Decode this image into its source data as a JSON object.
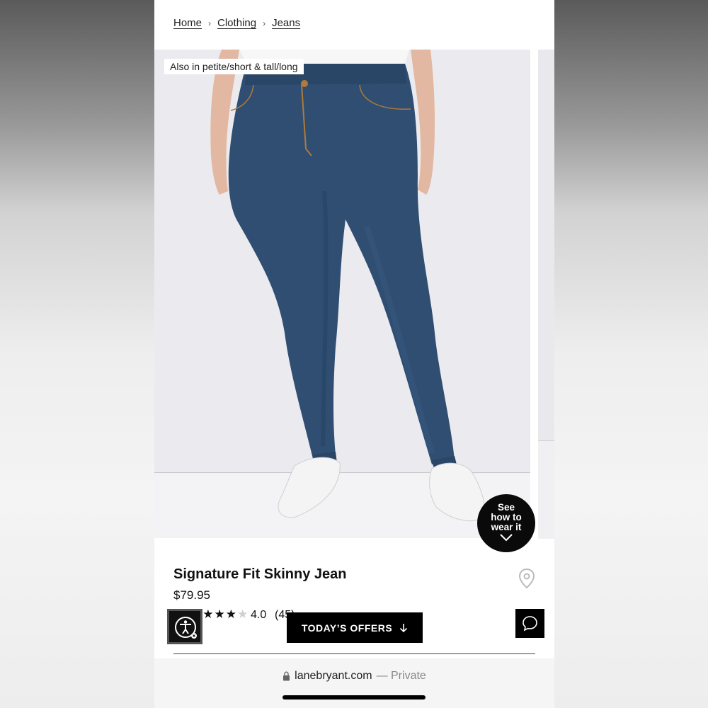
{
  "breadcrumb": {
    "items": [
      "Home",
      "Clothing",
      "Jeans"
    ],
    "separator": "›"
  },
  "gallery": {
    "badge": "Also in petite/short & tall/long",
    "see_how": {
      "line1": "See",
      "line2": "how to",
      "line3": "wear it"
    }
  },
  "product": {
    "title": "Signature Fit Skinny Jean",
    "price": "$79.95",
    "stars_filled": "★★★★",
    "stars_empty": "★",
    "rating": "4.0",
    "rating_count": "(45)"
  },
  "actions": {
    "offers_label": "TODAY’S OFFERS"
  },
  "browser": {
    "domain": "lanebryant.com",
    "mode": "— Private"
  },
  "colors": {
    "brand_black": "#000000",
    "denim": "#2f4e72"
  }
}
